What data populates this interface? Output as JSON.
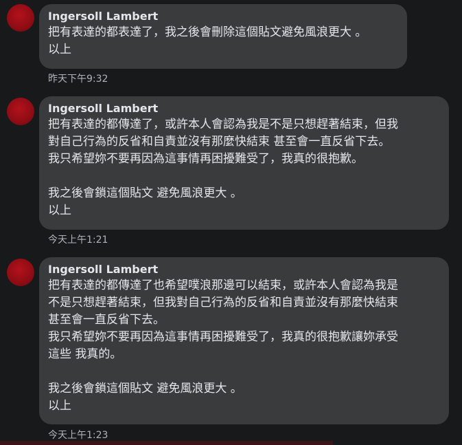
{
  "comments": [
    {
      "author": "Ingersoll Lambert",
      "lines": [
        "把有表達的都表達了，我之後會刪除這個貼文避免風浪更大 。",
        "以上"
      ],
      "timestamp": "昨天下午9:32"
    },
    {
      "author": "Ingersoll Lambert",
      "lines": [
        "把有表達的都傳達了，或許本人會認為我是不是只想趕著結束，但我",
        "對自己行為的反省和自責並沒有那麼快結束 甚至會一直反省下去。",
        "我只希望妳不要再因為這事情再困擾難受了，我真的很抱歉。",
        "",
        "我之後會鎖這個貼文 避免風浪更大 。",
        "以上"
      ],
      "timestamp": "今天上午1:21"
    },
    {
      "author": "Ingersoll Lambert",
      "lines": [
        "把有表達的都傳達了也希望噗浪那邊可以結束，或許本人會認為我是",
        "不是只想趕著結束，但我對自己行為的反省和自責並沒有那麼快結束",
        "甚至會一直反省下去。",
        "我只希望妳不要再因為這事情再困擾難受了，我真的很抱歉讓妳承受",
        "這些 我真的。",
        "",
        "我之後會鎖這個貼文 避免風浪更大 。",
        "以上"
      ],
      "timestamp": "今天上午1:23"
    }
  ]
}
